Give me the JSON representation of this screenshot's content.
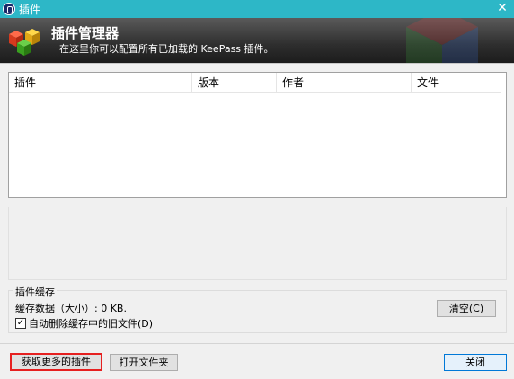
{
  "window": {
    "title": "插件",
    "close_glyph": "✕"
  },
  "banner": {
    "title": "插件管理器",
    "subtitle": "在这里你可以配置所有已加载的 KeePass 插件。",
    "logo_icon": "plugin-cubes-icon"
  },
  "plugin_list": {
    "columns": [
      "插件",
      "版本",
      "作者",
      "文件"
    ],
    "rows": []
  },
  "cache": {
    "group_label": "插件缓存",
    "data_text": "缓存数据（大小）: 0 KB.",
    "checkbox_label": "自动删除缓存中的旧文件(D)",
    "checkbox_checked": true,
    "clear_button": "清空(C)"
  },
  "footer": {
    "get_more_button": "获取更多的插件",
    "open_folder_button": "打开文件夹",
    "close_button": "关闭"
  },
  "colors": {
    "titlebar": "#2db7c7",
    "highlight_border": "#e62020",
    "default_button_border": "#0078d7"
  }
}
